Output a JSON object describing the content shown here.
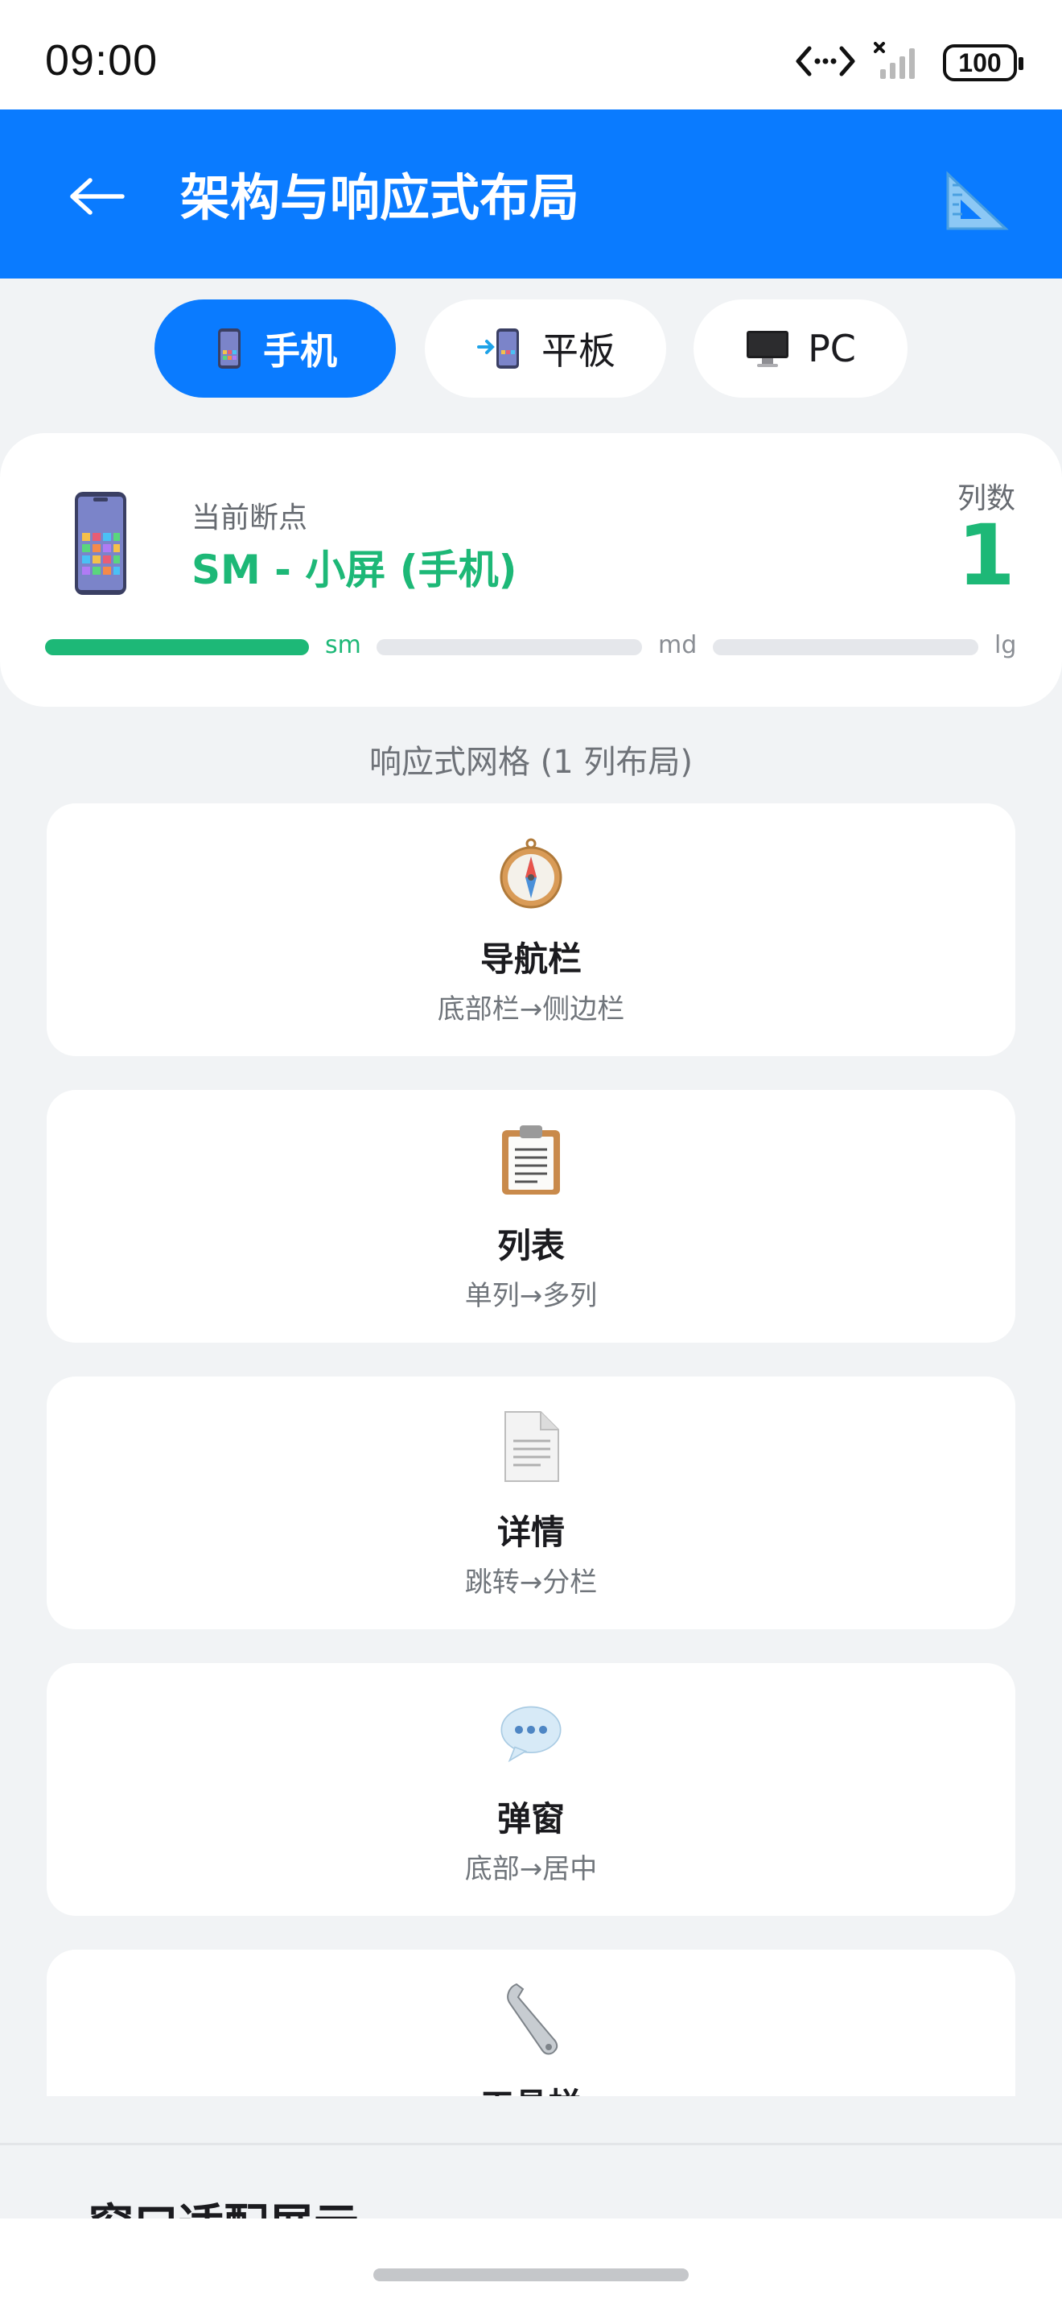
{
  "status_bar": {
    "time": "09:00",
    "battery": "100",
    "icons": [
      "code-arrows-icon",
      "no-signal-icon",
      "battery-icon"
    ]
  },
  "app_bar": {
    "title": "架构与响应式布局",
    "back_icon": "arrow-left-icon",
    "action_icon": "ruler-icon",
    "color": "#0A7BFF"
  },
  "device_tabs": [
    {
      "label": "手机",
      "icon": "phone-icon",
      "active": true
    },
    {
      "label": "平板",
      "icon": "tablet-icon",
      "active": false
    },
    {
      "label": "PC",
      "icon": "monitor-icon",
      "active": false
    }
  ],
  "breakpoint": {
    "label": "当前断点",
    "value": "SM - 小屏 (手机)",
    "columns_label": "列数",
    "columns_value": "1",
    "bars": [
      {
        "label": "sm",
        "active": true
      },
      {
        "label": "md",
        "active": false
      },
      {
        "label": "lg",
        "active": false
      }
    ],
    "accent": "#1DB877"
  },
  "grid": {
    "title": "响应式网格 (1 列布局)",
    "items": [
      {
        "title": "导航栏",
        "subtitle": "底部栏→侧边栏",
        "icon": "compass-icon"
      },
      {
        "title": "列表",
        "subtitle": "单列→多列",
        "icon": "clipboard-icon"
      },
      {
        "title": "详情",
        "subtitle": "跳转→分栏",
        "icon": "document-icon"
      },
      {
        "title": "弹窗",
        "subtitle": "底部→居中",
        "icon": "speech-bubble-icon"
      },
      {
        "title": "工具栏",
        "subtitle": "",
        "icon": "wrench-icon"
      }
    ]
  },
  "next_section": {
    "title": "窗口适配展示"
  }
}
